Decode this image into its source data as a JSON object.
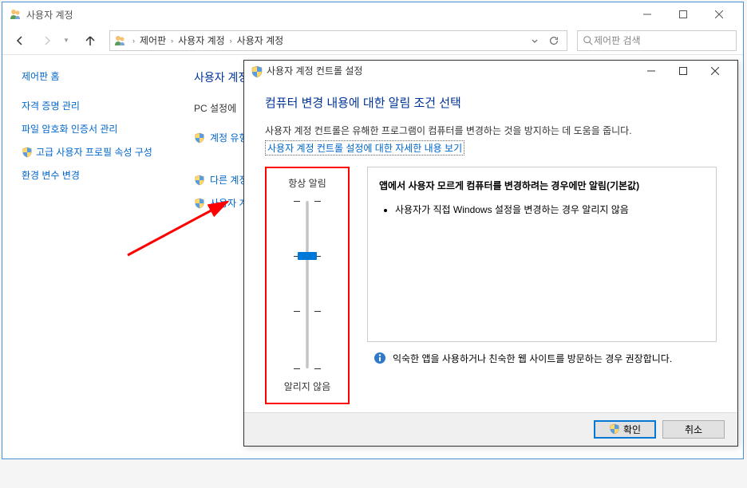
{
  "main_window": {
    "title": "사용자 계정",
    "breadcrumb": [
      "제어판",
      "사용자 계정",
      "사용자 계정"
    ],
    "search_placeholder": "제어판 검색"
  },
  "sidebar": {
    "heading": "제어판 홈",
    "links": [
      {
        "label": "자격 증명 관리",
        "shield": false
      },
      {
        "label": "파일 암호화 인증서 관리",
        "shield": false
      },
      {
        "label": "고급 사용자 프로필 속성 구성",
        "shield": true
      },
      {
        "label": "환경 변수 변경",
        "shield": false
      }
    ]
  },
  "main_content": {
    "heading": "사용자 계정",
    "section1_label": "PC 설정에",
    "actions": [
      {
        "label": "계정 유형",
        "shield": true
      },
      {
        "label": "다른 계정",
        "shield": true
      },
      {
        "label": "사용자 계",
        "shield": true
      }
    ]
  },
  "uac": {
    "title": "사용자 계정 컨트롤 설정",
    "heading": "컴퓨터 변경 내용에 대한 알림 조건 선택",
    "description": "사용자 계정 컨트롤은 유해한 프로그램이 컴퓨터를 변경하는 것을 방지하는 데 도움을 줍니다.",
    "more_link": "사용자 계정 컨트롤 설정에 대한 자세한 내용 보기",
    "slider": {
      "top_label": "항상 알림",
      "bottom_label": "알리지 않음",
      "position": 1,
      "ticks": 4
    },
    "info": {
      "title": "앱에서 사용자 모르게 컴퓨터를 변경하려는 경우에만 알림(기본값)",
      "bullet": "사용자가 직접 Windows 설정을 변경하는 경우 알리지 않음"
    },
    "recommend": "익숙한 앱을 사용하거나 친숙한 웹 사이트를 방문하는 경우 권장합니다.",
    "ok_label": "확인",
    "cancel_label": "취소"
  }
}
